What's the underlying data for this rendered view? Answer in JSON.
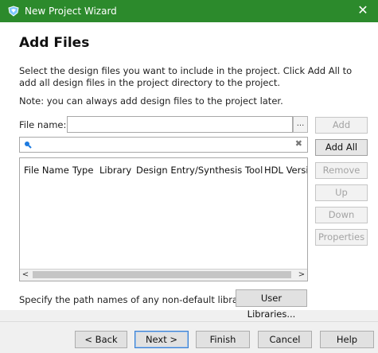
{
  "window": {
    "title": "New Project Wizard",
    "close_glyph": "✕",
    "titlebar_color": "#2c8a2c"
  },
  "header": {
    "heading": "Add Files",
    "description": "Select the design files you want to include in the project. Click Add All to add all design files in the project directory to the project.",
    "note": "Note: you can always add design files to the project later."
  },
  "file_name": {
    "label": "File name:",
    "value": "",
    "browse_label": "..."
  },
  "search": {
    "icon": "search-icon",
    "value": "",
    "clear_glyph": "✖"
  },
  "table": {
    "columns": [
      "File Name",
      "Type",
      "Library",
      "Design Entry/Synthesis Tool",
      "HDL Versi"
    ],
    "rows": [],
    "scroll_left": "<",
    "scroll_right": ">"
  },
  "side_buttons": {
    "add": "Add",
    "add_all": "Add All",
    "remove": "Remove",
    "up": "Up",
    "down": "Down",
    "properties": "Properties"
  },
  "libraries": {
    "label": "Specify the path names of any non-default libraries.",
    "button": "User Libraries..."
  },
  "footer": {
    "back": "< Back",
    "next": "Next >",
    "finish": "Finish",
    "cancel": "Cancel",
    "help": "Help"
  }
}
